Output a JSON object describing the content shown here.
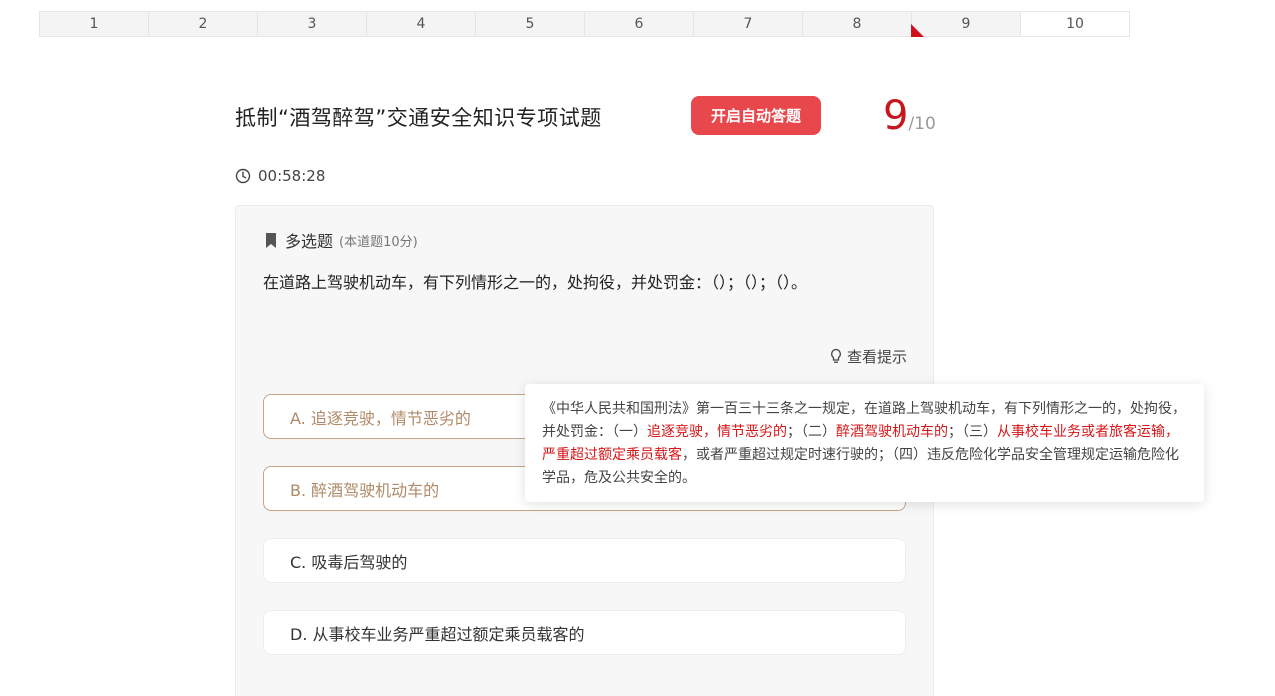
{
  "tabs": [
    {
      "label": "1"
    },
    {
      "label": "2"
    },
    {
      "label": "3"
    },
    {
      "label": "4"
    },
    {
      "label": "5"
    },
    {
      "label": "6"
    },
    {
      "label": "7"
    },
    {
      "label": "8"
    },
    {
      "label": "9"
    },
    {
      "label": "10"
    }
  ],
  "header": {
    "title": "抵制“酒驾醉驾”交通安全知识专项试题",
    "auto_answer_button": "开启自动答题",
    "progress_current": "9",
    "progress_total": "/10",
    "timer": "00:58:28"
  },
  "question": {
    "type": "多选题",
    "score": "(本道题10分)",
    "text": "在道路上驾驶机动车，有下列情形之一的，处拘役，并处罚金：（）；（）；（）。",
    "hint_link": "查看提示",
    "options": [
      {
        "label": "A. 追逐竞驶，情节恶劣的",
        "selected": true
      },
      {
        "label": "B. 醉酒驾驶机动车的",
        "selected": true
      },
      {
        "label": "C. 吸毒后驾驶的",
        "selected": false
      },
      {
        "label": "D. 从事校车业务严重超过额定乘员载客的",
        "selected": false
      }
    ]
  },
  "hint": {
    "part1": "《中华人民共和国刑法》第一百三十三条之一规定，在道路上驾驶机动车，有下列情形之一的，处拘役，并处罚金：（一）",
    "hl1": "追逐竞驶，情节恶劣的",
    "part2": "；（二）",
    "hl2": "醉酒驾驶机动车的",
    "part3": "；（三）",
    "hl3": "从事校车业务或者旅客运输，严重超过额定乘员载客",
    "part4": "，或者严重超过规定时速行驶的；（四）违反危险化学品安全管理规定运输危险化学品，危及公共安全的。"
  },
  "colors": {
    "accent_red": "#c8161d",
    "button_red": "#e8474c",
    "selected_border": "#c4a58a",
    "hint_highlight": "#d71518"
  },
  "icons": {
    "timer": "clock-icon",
    "question_type": "bookmark-icon",
    "hint": "lightbulb-icon"
  }
}
